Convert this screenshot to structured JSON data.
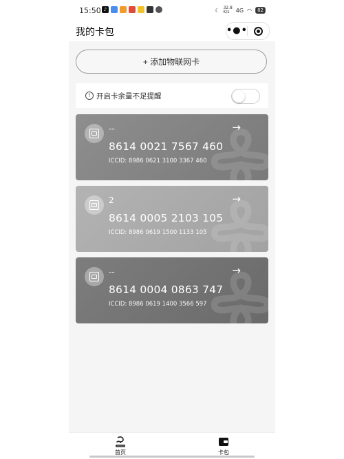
{
  "status_bar": {
    "time": "15:50",
    "app_icons": [
      {
        "name": "tiktok-icon",
        "glyph": "♪",
        "color": "#111111"
      },
      {
        "name": "app-icon-blue",
        "glyph": "",
        "color": "#4a8ef0"
      },
      {
        "name": "app-icon-orange",
        "glyph": "",
        "color": "#f29b2b"
      },
      {
        "name": "app-icon-red",
        "glyph": "",
        "color": "#e04a3a"
      },
      {
        "name": "app-icon-yellow",
        "glyph": "",
        "color": "#f2c12a"
      },
      {
        "name": "app-icon-dark",
        "glyph": "",
        "color": "#333333"
      },
      {
        "name": "gear-icon",
        "glyph": "",
        "color": "#555555"
      }
    ],
    "network_speed": "32.8\nK/s",
    "signal": "4G",
    "battery": "82"
  },
  "nav": {
    "title": "我的卡包",
    "more_label": "•●•"
  },
  "add_button": {
    "label": "+ 添加物联网卡"
  },
  "reminder": {
    "icon": "!",
    "label": "开启卡余量不足提醒",
    "enabled": false
  },
  "cards": [
    {
      "name": "--",
      "number": "8614 0021 7567 460",
      "iccid": "ICCID: 8986 0621 3100 3367 460",
      "color_from": "#8e8e8e",
      "color_to": "#7a7a7a",
      "arrow": "→"
    },
    {
      "name": "2",
      "number": "8614 0005 2103 105",
      "iccid": "ICCID: 8986 0619 1500 1133 105",
      "color_from": "#b3b3b3",
      "color_to": "#a2a2a2",
      "arrow": "→"
    },
    {
      "name": "--",
      "number": "8614 0004 0863 747",
      "iccid": "ICCID: 8986 0619 1400 3566 597",
      "color_from": "#7d7d7d",
      "color_to": "#6a6a6a",
      "arrow": "→"
    }
  ],
  "tabbar": {
    "tabs": [
      {
        "label": "首页",
        "icon": "home-icon"
      },
      {
        "label": "卡包",
        "icon": "wallet-icon"
      }
    ],
    "active": "卡包"
  }
}
